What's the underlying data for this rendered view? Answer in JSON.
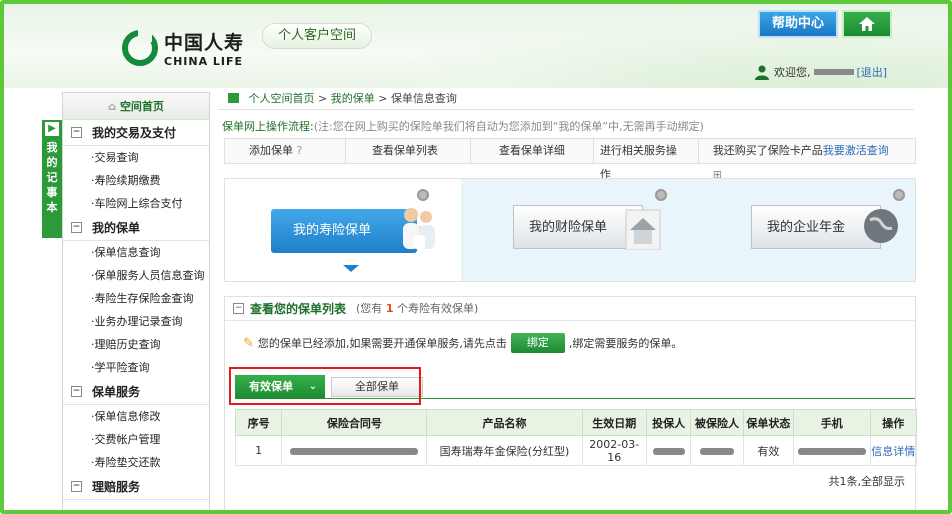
{
  "header": {
    "logo_cn": "中国人寿",
    "logo_en": "CHINA LIFE",
    "portal_tag": "个人客户空间",
    "help_label": "帮助中心",
    "welcome_prefix": "欢迎您,",
    "logout_label": "[退出]"
  },
  "side_tab": {
    "chars": [
      "我",
      "的",
      "记",
      "事",
      "本"
    ]
  },
  "sidebar": {
    "home_label": "空间首页",
    "groups": [
      {
        "title": "我的交易及支付",
        "items": [
          "·交易查询",
          "·寿险续期缴费",
          "·车险网上综合支付"
        ]
      },
      {
        "title": "我的保单",
        "items": [
          "·保单信息查询",
          "·保单服务人员信息查询",
          "·寿险生存保险金查询",
          "·业务办理记录查询",
          "·理赔历史查询",
          "·学平险查询"
        ]
      },
      {
        "title": "保单服务",
        "items": [
          "·保单信息修改",
          "·交费帐户管理",
          "·寿险垫交还款"
        ]
      },
      {
        "title": "理赔服务",
        "items": []
      }
    ]
  },
  "breadcrumb": {
    "home": "个人空间首页",
    "sep": ">",
    "section": "我的保单",
    "current": "保单信息查询"
  },
  "flow": {
    "label": "保单网上操作流程:",
    "note": "(注:您在网上购买的保险单我们将自动为您添加到“我的保单”中,无需再手动绑定)"
  },
  "steps": {
    "s1": "添加保单",
    "s2": "查看保单列表",
    "s3": "查看保单详细",
    "s4": "进行相关服务操作",
    "s5_prefix": "我还购买了保险卡产品",
    "s5_link": "我要激活查询"
  },
  "products": {
    "life": "我的寿险保单",
    "property": "我的财险保单",
    "annuity": "我的企业年金"
  },
  "policy_panel": {
    "title": "查看您的保单列表",
    "sub_prefix": "(您有",
    "count": "1",
    "sub_suffix": "个寿险有效保单)",
    "notice_prefix": "您的保单已经添加,如果需要开通保单服务,请先点击",
    "bind_label": "绑定",
    "notice_suffix": ",绑定需要服务的保单。",
    "tab_effective": "有效保单",
    "tab_all": "全部保单",
    "total": "共1条,全部显示"
  },
  "table": {
    "headers": [
      "序号",
      "保险合同号",
      "产品名称",
      "生效日期",
      "投保人",
      "被保险人",
      "保单状态",
      "手机",
      "操作"
    ],
    "rows": [
      {
        "no": "1",
        "product": "国寿瑞寿年金保险(分红型)",
        "date": "2002-03-16",
        "status": "有效",
        "action": "信息详情"
      }
    ]
  },
  "colors": {
    "brand_green": "#2d9a3a",
    "accent_blue": "#1f7fca",
    "highlight_red": "#e01c1c"
  }
}
